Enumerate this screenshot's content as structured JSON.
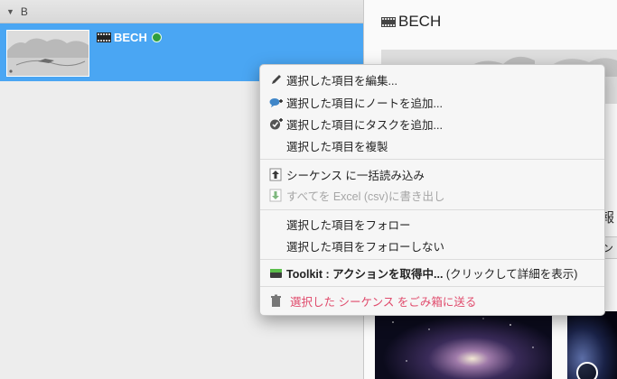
{
  "list": {
    "group_label": "B",
    "selected_row": {
      "title": "BECH",
      "status_color": "#2f9e3f"
    }
  },
  "detail": {
    "title": "BECH",
    "side_label": "報",
    "side_bar_text": "ン"
  },
  "context_menu": {
    "items": [
      {
        "label": "選択した項目を編集...",
        "icon": "pencil-icon"
      },
      {
        "label": "選択した項目にノートを追加...",
        "icon": "note-add-icon"
      },
      {
        "label": "選択した項目にタスクを追加...",
        "icon": "task-add-icon"
      },
      {
        "label": "選択した項目を複製",
        "icon": ""
      },
      {
        "label": "シーケンス に一括読み込み",
        "icon": "upload-icon"
      },
      {
        "label": "すべてを Excel (csv)に書き出し",
        "icon": "download-icon",
        "disabled": true
      },
      {
        "label": "選択した項目をフォロー",
        "icon": ""
      },
      {
        "label": "選択した項目をフォローしない",
        "icon": ""
      },
      {
        "label_bold": "Toolkit : アクションを取得中...",
        "label_rest": " (クリックして詳細を表示)",
        "icon": "toolkit-icon"
      },
      {
        "label": "選択した シーケンス をごみ箱に送る",
        "icon": "trash-icon",
        "danger_color": "#e04b6c"
      }
    ]
  },
  "colors": {
    "selection": "#4aa6f3",
    "danger": "#e04b6c"
  }
}
